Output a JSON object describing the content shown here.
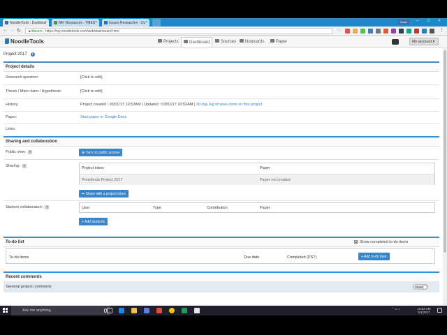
{
  "browser": {
    "tabs": [
      {
        "label": "NoodleTools : Dashboa"
      },
      {
        "label": "NR: Resources - TMES"
      },
      {
        "label": "Issues Researcher - Dc"
      }
    ],
    "user_badge": "Duda",
    "secure_label": "Secure",
    "url": "https://my.noodletools.com/web/dashboard.html"
  },
  "app": {
    "logo": "NoodleTools",
    "nav": [
      {
        "label": "Projects",
        "icon": "folder-icon"
      },
      {
        "label": "Dashboard",
        "icon": "dashboard-icon"
      },
      {
        "label": "Sources",
        "icon": "sources-icon"
      },
      {
        "label": "Notecards",
        "icon": "notecards-icon"
      },
      {
        "label": "Paper",
        "icon": "paper-icon"
      }
    ],
    "account_label": "My account"
  },
  "project": {
    "title": "Project 2017",
    "details": {
      "heading": "Project details",
      "research_question_label": "Research question:",
      "research_question_value": "[Click to edit]",
      "thesis_label": "Thesis / Main claim / Hypothesis:",
      "thesis_value": "[Click to edit]",
      "history_label": "History:",
      "history_value": "Project created : 03/01/17 10:52AM | Updated : 03/01/17 10:52AM |",
      "history_link": "30-day log of work done on this project",
      "paper_label": "Paper:",
      "paper_link": "Start paper in Google Docs",
      "links_label": "Links:"
    },
    "sharing": {
      "heading": "Sharing and collaboration",
      "public_view_label": "Public view:",
      "public_access_button": "Turn on public access",
      "sharing_label": "Sharing:",
      "inbox_table": {
        "headers": [
          "Project inbox",
          "Paper"
        ],
        "rows": [
          [
            "Presidents Project 2017",
            "Paper not created"
          ]
        ]
      },
      "share_button": "Share with a project inbox",
      "collab_label": "Student collaboration:",
      "collab_table": {
        "headers": [
          "User",
          "Type",
          "Contribution",
          "Paper"
        ]
      },
      "add_students_button": "Add students"
    },
    "todo": {
      "heading": "To-do list",
      "show_completed_label": "Show completed to-do items",
      "headers": [
        "To-do items",
        "Due date",
        "Completed (PST)"
      ],
      "add_button": "Add to-do item"
    },
    "comments": {
      "heading": "Recent comments",
      "general_label": "General project comments",
      "toggle_label": "Done"
    }
  },
  "taskbar": {
    "search_placeholder": "Ask me anything",
    "time": "10:53 AM",
    "date": "3/1/2017"
  }
}
